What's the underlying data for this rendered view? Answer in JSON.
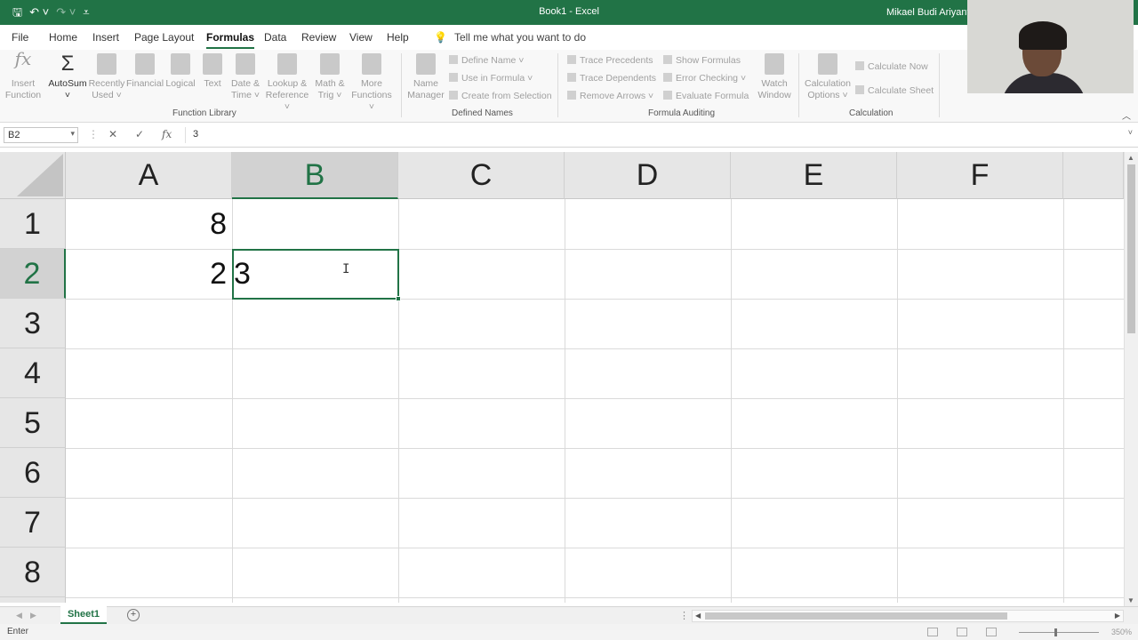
{
  "titlebar": {
    "title": "Book1  -  Excel",
    "user": "Mikael Budi Ariyanto",
    "qat": {
      "save_icon": "save-icon",
      "undo_icon": "undo-icon",
      "redo_icon": "redo-icon",
      "customize_icon": "customize-qat-icon"
    }
  },
  "menu": {
    "tabs": [
      "File",
      "Home",
      "Insert",
      "Page Layout",
      "Formulas",
      "Data",
      "Review",
      "View",
      "Help"
    ],
    "active_tab": "Formulas",
    "tell_me": "Tell me what you want to do"
  },
  "ribbon": {
    "function_library": {
      "label": "Function Library",
      "insert_function": [
        "Insert",
        "Function"
      ],
      "autosum": "AutoSum",
      "recently_used": [
        "Recently",
        "Used ˅"
      ],
      "financial": "Financial",
      "logical": "Logical",
      "text": "Text",
      "date_time": [
        "Date &",
        "Time ˅"
      ],
      "lookup": [
        "Lookup &",
        "Reference ˅"
      ],
      "math": [
        "Math &",
        "Trig ˅"
      ],
      "more": [
        "More",
        "Functions ˅"
      ]
    },
    "defined_names": {
      "label": "Defined Names",
      "name_manager": [
        "Name",
        "Manager"
      ],
      "define_name": "Define Name  ˅",
      "use_in_formula": "Use in Formula ˅",
      "create_from_selection": "Create from Selection"
    },
    "formula_auditing": {
      "label": "Formula Auditing",
      "trace_precedents": "Trace Precedents",
      "trace_dependents": "Trace Dependents",
      "remove_arrows": "Remove Arrows  ˅",
      "show_formulas": "Show Formulas",
      "error_checking": "Error Checking   ˅",
      "evaluate_formula": "Evaluate Formula",
      "watch_window": [
        "Watch",
        "Window"
      ]
    },
    "calculation": {
      "label": "Calculation",
      "options": [
        "Calculation",
        "Options ˅"
      ],
      "calculate_now": "Calculate Now",
      "calculate_sheet": "Calculate Sheet"
    }
  },
  "formula_bar": {
    "name_box": "B2",
    "content": "3",
    "cancel_icon": "✕",
    "enter_icon": "✓",
    "fx": "fx"
  },
  "grid": {
    "columns": [
      "A",
      "B",
      "C",
      "D",
      "E",
      "F"
    ],
    "rows": [
      "1",
      "2",
      "3",
      "4",
      "5",
      "6",
      "7",
      "8"
    ],
    "selected_column": "B",
    "selected_row": "2",
    "cells": {
      "A1": "8",
      "A2": "2",
      "B2": "3"
    }
  },
  "sheets": {
    "tabs": [
      "Sheet1"
    ],
    "active": "Sheet1"
  },
  "status": {
    "mode": "Enter",
    "zoom": "350%"
  },
  "colors": {
    "excel_green": "#217346"
  }
}
